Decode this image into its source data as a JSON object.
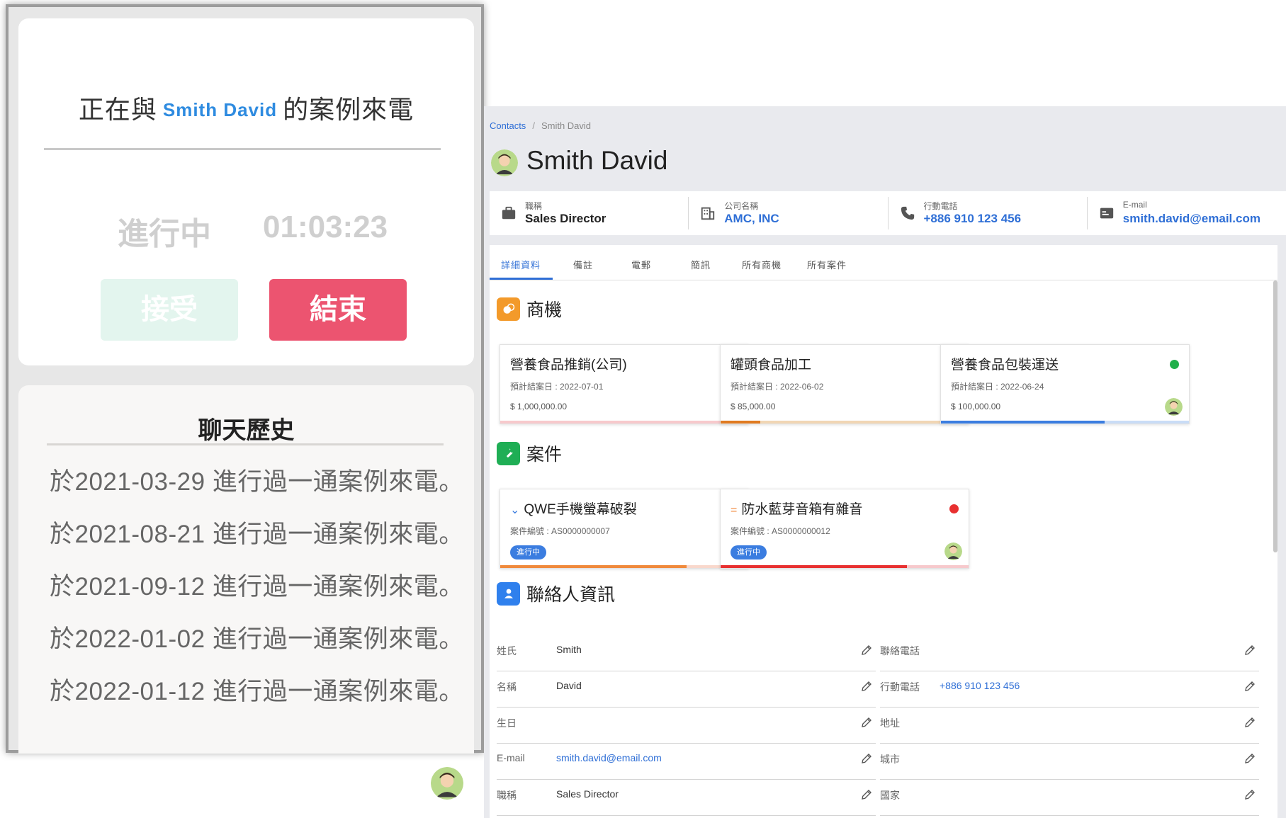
{
  "call": {
    "title_prefix": "正在與",
    "contact_name": "Smith David",
    "title_suffix": "的案例來電",
    "status": "進行中",
    "timer": "01:03:23",
    "accept_label": "接受",
    "end_label": "結束"
  },
  "history": {
    "title": "聊天歷史",
    "items": [
      "於2021-03-29 進行過一通案例來電。",
      "於2021-08-21 進行過一通案例來電。",
      "於2021-09-12 進行過一通案例來電。",
      "於2022-01-02 進行過一通案例來電。",
      "於2022-01-12 進行過一通案例來電。"
    ]
  },
  "breadcrumb": {
    "root": "Contacts",
    "separator": "/",
    "current": "Smith David"
  },
  "contact": {
    "name": "Smith David"
  },
  "info_strip": [
    {
      "label": "職稱",
      "value": "Sales Director",
      "icon": "briefcase-icon"
    },
    {
      "label": "公司名稱",
      "value": "AMC, INC",
      "icon": "building-icon"
    },
    {
      "label": "行動電話",
      "value": "+886 910 123 456",
      "icon": "phone-icon"
    },
    {
      "label": "E-mail",
      "value": "smith.david@email.com",
      "icon": "mail-icon"
    }
  ],
  "tabs": [
    "詳細資料",
    "備註",
    "電郵",
    "簡訊",
    "所有商機",
    "所有案件"
  ],
  "sections": {
    "opportunities": "商機",
    "cases": "案件",
    "contact_info": "聯絡人資訊"
  },
  "opportunities": [
    {
      "title": "營養食品推銷(公司)",
      "due": "預計結案日 : 2022-07-01",
      "amount": "$ 1,000,000.00",
      "status_color": "#e83030",
      "progress": 0
    },
    {
      "title": "罐頭食品加工",
      "due": "預計結案日 : 2022-06-02",
      "amount": "$ 85,000.00",
      "status_color": "#21b04b",
      "progress": 0.16
    },
    {
      "title": "營養食品包裝運送",
      "due": "預計結案日 : 2022-06-24",
      "amount": "$ 100,000.00",
      "status_color": "#21b04b",
      "progress": 0.66
    }
  ],
  "cases": [
    {
      "prefix_icon": "chevron-down-icon",
      "title": "QWE手機螢幕破裂",
      "number": "案件編號 : AS0000000007",
      "badge": "進行中",
      "status_color": "#f08a3c",
      "progress": 0.75
    },
    {
      "prefix_icon": "equals-icon",
      "title": "防水藍芽音箱有雜音",
      "number": "案件編號 : AS0000000012",
      "badge": "進行中",
      "status_color": "#e83030",
      "progress": 0.75
    }
  ],
  "contact_fields_left": [
    {
      "label": "姓氏",
      "value": "Smith"
    },
    {
      "label": "名稱",
      "value": "David"
    },
    {
      "label": "生日",
      "value": ""
    },
    {
      "label": "E-mail",
      "value": "smith.david@email.com",
      "link": true
    },
    {
      "label": "職稱",
      "value": "Sales Director"
    }
  ],
  "contact_fields_right": [
    {
      "label": "聯絡電話",
      "value": ""
    },
    {
      "label": "行動電話",
      "value": "+886 910 123 456",
      "link": true
    },
    {
      "label": "地址",
      "value": ""
    },
    {
      "label": "城市",
      "value": ""
    },
    {
      "label": "國家",
      "value": ""
    }
  ],
  "colors": {
    "accent": "#2f6fd6",
    "end_button": "#ec5470",
    "accept_button": "#e3f5ee",
    "opp_icon_bg": "#f39a2a",
    "case_icon_bg": "#1fae55",
    "contact_icon_bg": "#2f80ed"
  }
}
